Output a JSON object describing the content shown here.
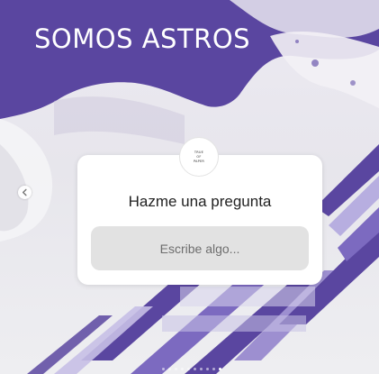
{
  "story": {
    "title": "SOMOS ASTROS",
    "avatar_lines": [
      "TRUE",
      "OF",
      "PAPER"
    ],
    "question": "Hazme una pregunta",
    "answer_placeholder": "Escribe algo...",
    "progress": {
      "total": 10,
      "current": 10
    }
  },
  "icons": {
    "prev": "chevron-left-icon"
  },
  "colors": {
    "accent_purple": "#5a46a0",
    "card_background": "#ffffff",
    "input_background": "#e2e2e2",
    "title_text": "#ffffff"
  }
}
